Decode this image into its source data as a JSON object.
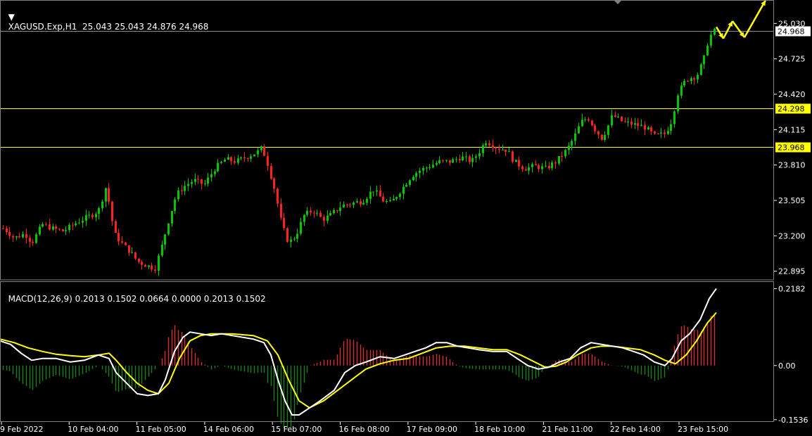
{
  "header": {
    "symbol_line": "XAGUSD.Exp,H1",
    "ohlc": "25.043 25.043 24.876 24.968",
    "macd_line": "MACD(12,26,9) 0.2013 0.1502 0.0664 0.0000 0.2013 0.1502"
  },
  "colors": {
    "background": "#000000",
    "bull_candle": "#00c800",
    "bear_candle": "#ff2020",
    "level_line": "#ffff00",
    "bid_line": "#8c8ca0",
    "macd_main": "#ffffff",
    "macd_signal": "#ffff00",
    "hist_pos": "#c83232",
    "hist_neg": "#1e781e",
    "arrow": "#ffff00"
  },
  "chart_data": [
    {
      "type": "candlestick",
      "symbol": "XAGUSD.Exp",
      "timeframe": "H1",
      "ylim": [
        22.82,
        25.22
      ],
      "y_ticks": [
        "25.030",
        "24.725",
        "24.420",
        "24.115",
        "23.810",
        "23.505",
        "23.200",
        "22.895"
      ],
      "x_ticks": [
        "9 Feb 2022",
        "10 Feb 04:00",
        "11 Feb 05:00",
        "14 Feb 06:00",
        "15 Feb 07:00",
        "16 Feb 08:00",
        "17 Feb 09:00",
        "18 Feb 10:00",
        "21 Feb 11:00",
        "22 Feb 14:00",
        "23 Feb 15:00"
      ],
      "horizontal_levels": [
        {
          "label": "24.298",
          "value": 24.298,
          "style": "level"
        },
        {
          "label": "23.968",
          "value": 23.968,
          "style": "level"
        },
        {
          "label": "24.968",
          "value": 24.968,
          "style": "bid"
        }
      ],
      "path": [
        [
          0,
          23.28
        ],
        [
          10,
          23.24
        ],
        [
          20,
          23.18
        ],
        [
          35,
          23.22
        ],
        [
          45,
          23.14
        ],
        [
          60,
          23.3
        ],
        [
          75,
          23.26
        ],
        [
          90,
          23.24
        ],
        [
          110,
          23.32
        ],
        [
          130,
          23.38
        ],
        [
          140,
          23.42
        ],
        [
          150,
          23.62
        ],
        [
          155,
          23.48
        ],
        [
          162,
          23.22
        ],
        [
          175,
          23.12
        ],
        [
          185,
          23.06
        ],
        [
          195,
          22.98
        ],
        [
          210,
          22.94
        ],
        [
          220,
          22.92
        ],
        [
          230,
          23.12
        ],
        [
          240,
          23.35
        ],
        [
          250,
          23.55
        ],
        [
          260,
          23.62
        ],
        [
          275,
          23.68
        ],
        [
          290,
          23.64
        ],
        [
          305,
          23.78
        ],
        [
          320,
          23.86
        ],
        [
          335,
          23.84
        ],
        [
          350,
          23.88
        ],
        [
          365,
          23.92
        ],
        [
          372,
          23.96
        ],
        [
          380,
          23.82
        ],
        [
          390,
          23.6
        ],
        [
          400,
          23.3
        ],
        [
          410,
          23.14
        ],
        [
          420,
          23.2
        ],
        [
          432,
          23.38
        ],
        [
          445,
          23.42
        ],
        [
          458,
          23.34
        ],
        [
          470,
          23.38
        ],
        [
          485,
          23.46
        ],
        [
          500,
          23.48
        ],
        [
          515,
          23.5
        ],
        [
          530,
          23.6
        ],
        [
          545,
          23.5
        ],
        [
          555,
          23.48
        ],
        [
          565,
          23.56
        ],
        [
          575,
          23.64
        ],
        [
          585,
          23.72
        ],
        [
          595,
          23.76
        ],
        [
          610,
          23.8
        ],
        [
          625,
          23.84
        ],
        [
          640,
          23.84
        ],
        [
          655,
          23.88
        ],
        [
          670,
          23.84
        ],
        [
          680,
          23.92
        ],
        [
          690,
          24.02
        ],
        [
          705,
          23.96
        ],
        [
          720,
          23.94
        ],
        [
          730,
          23.84
        ],
        [
          745,
          23.78
        ],
        [
          760,
          23.8
        ],
        [
          775,
          23.78
        ],
        [
          790,
          23.84
        ],
        [
          805,
          23.94
        ],
        [
          815,
          24.04
        ],
        [
          825,
          24.18
        ],
        [
          835,
          24.22
        ],
        [
          845,
          24.12
        ],
        [
          855,
          24.04
        ],
        [
          862,
          24.12
        ],
        [
          870,
          24.24
        ],
        [
          885,
          24.18
        ],
        [
          900,
          24.16
        ],
        [
          915,
          24.14
        ],
        [
          930,
          24.06
        ],
        [
          945,
          24.08
        ],
        [
          955,
          24.2
        ],
        [
          962,
          24.42
        ],
        [
          975,
          24.55
        ],
        [
          990,
          24.58
        ],
        [
          1000,
          24.72
        ],
        [
          1005,
          24.86
        ],
        [
          1012,
          24.96
        ],
        [
          1018,
          24.97
        ]
      ],
      "forecast_arrows": [
        [
          [
            1018,
            25.0
          ],
          [
            1028,
            24.9
          ]
        ],
        [
          [
            1028,
            24.9
          ],
          [
            1041,
            25.05
          ]
        ],
        [
          [
            1041,
            25.05
          ],
          [
            1058,
            24.91
          ]
        ],
        [
          [
            1058,
            24.91
          ],
          [
            1088,
            25.23
          ]
        ]
      ]
    },
    {
      "type": "macd",
      "params": "12,26,9",
      "ylim": [
        -0.16,
        0.235
      ],
      "y_ticks": [
        "0.2182",
        "0.00",
        "-0.1536"
      ],
      "main_path": [
        [
          0,
          0.07
        ],
        [
          15,
          0.06
        ],
        [
          30,
          0.035
        ],
        [
          45,
          0.015
        ],
        [
          60,
          0.02
        ],
        [
          80,
          0.02
        ],
        [
          100,
          0.01
        ],
        [
          120,
          0.015
        ],
        [
          140,
          0.03
        ],
        [
          155,
          0.02
        ],
        [
          165,
          -0.02
        ],
        [
          180,
          -0.05
        ],
        [
          195,
          -0.08
        ],
        [
          210,
          -0.085
        ],
        [
          225,
          -0.08
        ],
        [
          235,
          -0.04
        ],
        [
          248,
          0.04
        ],
        [
          260,
          0.08
        ],
        [
          270,
          0.095
        ],
        [
          285,
          0.09
        ],
        [
          300,
          0.085
        ],
        [
          315,
          0.09
        ],
        [
          330,
          0.085
        ],
        [
          345,
          0.08
        ],
        [
          360,
          0.075
        ],
        [
          375,
          0.065
        ],
        [
          385,
          0.03
        ],
        [
          395,
          -0.04
        ],
        [
          405,
          -0.1
        ],
        [
          415,
          -0.14
        ],
        [
          425,
          -0.14
        ],
        [
          440,
          -0.12
        ],
        [
          455,
          -0.1
        ],
        [
          475,
          -0.07
        ],
        [
          490,
          -0.02
        ],
        [
          505,
          0.0
        ],
        [
          520,
          0.01
        ],
        [
          540,
          0.025
        ],
        [
          560,
          0.02
        ],
        [
          575,
          0.03
        ],
        [
          590,
          0.04
        ],
        [
          605,
          0.05
        ],
        [
          620,
          0.065
        ],
        [
          635,
          0.065
        ],
        [
          650,
          0.055
        ],
        [
          665,
          0.05
        ],
        [
          680,
          0.045
        ],
        [
          700,
          0.04
        ],
        [
          720,
          0.04
        ],
        [
          735,
          0.02
        ],
        [
          750,
          0.0
        ],
        [
          765,
          -0.01
        ],
        [
          780,
          -0.005
        ],
        [
          795,
          0.01
        ],
        [
          810,
          0.02
        ],
        [
          825,
          0.05
        ],
        [
          840,
          0.065
        ],
        [
          855,
          0.06
        ],
        [
          870,
          0.055
        ],
        [
          885,
          0.05
        ],
        [
          900,
          0.04
        ],
        [
          915,
          0.03
        ],
        [
          930,
          0.01
        ],
        [
          945,
          0.0
        ],
        [
          955,
          0.02
        ],
        [
          968,
          0.07
        ],
        [
          980,
          0.09
        ],
        [
          995,
          0.13
        ],
        [
          1008,
          0.19
        ],
        [
          1018,
          0.2182
        ]
      ],
      "signal_path": [
        [
          0,
          0.075
        ],
        [
          20,
          0.065
        ],
        [
          40,
          0.05
        ],
        [
          60,
          0.04
        ],
        [
          80,
          0.032
        ],
        [
          100,
          0.028
        ],
        [
          120,
          0.025
        ],
        [
          140,
          0.03
        ],
        [
          155,
          0.035
        ],
        [
          165,
          0.015
        ],
        [
          180,
          -0.02
        ],
        [
          195,
          -0.05
        ],
        [
          210,
          -0.07
        ],
        [
          225,
          -0.08
        ],
        [
          240,
          -0.05
        ],
        [
          255,
          0.02
        ],
        [
          270,
          0.07
        ],
        [
          285,
          0.085
        ],
        [
          300,
          0.09
        ],
        [
          330,
          0.09
        ],
        [
          360,
          0.085
        ],
        [
          380,
          0.07
        ],
        [
          395,
          0.03
        ],
        [
          410,
          -0.04
        ],
        [
          425,
          -0.1
        ],
        [
          440,
          -0.12
        ],
        [
          460,
          -0.1
        ],
        [
          480,
          -0.07
        ],
        [
          500,
          -0.04
        ],
        [
          520,
          -0.01
        ],
        [
          540,
          0.005
        ],
        [
          560,
          0.015
        ],
        [
          580,
          0.02
        ],
        [
          600,
          0.035
        ],
        [
          620,
          0.05
        ],
        [
          640,
          0.055
        ],
        [
          660,
          0.055
        ],
        [
          680,
          0.05
        ],
        [
          700,
          0.045
        ],
        [
          720,
          0.045
        ],
        [
          740,
          0.03
        ],
        [
          760,
          0.01
        ],
        [
          775,
          -0.005
        ],
        [
          790,
          -0.002
        ],
        [
          805,
          0.01
        ],
        [
          820,
          0.03
        ],
        [
          840,
          0.05
        ],
        [
          855,
          0.055
        ],
        [
          870,
          0.055
        ],
        [
          890,
          0.05
        ],
        [
          910,
          0.045
        ],
        [
          930,
          0.03
        ],
        [
          945,
          0.015
        ],
        [
          960,
          0.005
        ],
        [
          975,
          0.03
        ],
        [
          990,
          0.07
        ],
        [
          1005,
          0.12
        ],
        [
          1018,
          0.1502
        ]
      ]
    }
  ]
}
